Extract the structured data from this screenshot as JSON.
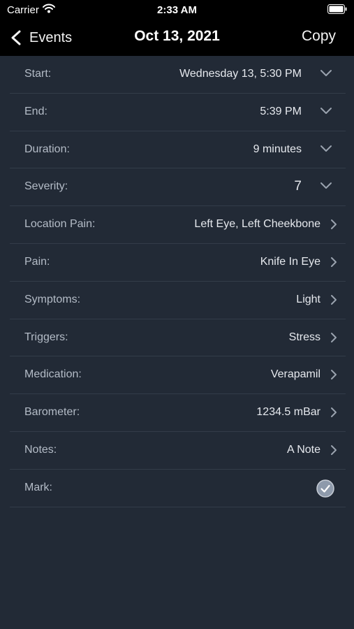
{
  "status_bar": {
    "carrier": "Carrier",
    "time": "2:33 AM"
  },
  "nav": {
    "back_label": "Events",
    "title": "Oct 13, 2021",
    "copy_label": "Copy"
  },
  "rows": [
    {
      "label": "Start:",
      "value": "Wednesday  13,  5:30 PM",
      "accessory": "chevron-down"
    },
    {
      "label": "End:",
      "value": "5:39 PM",
      "accessory": "chevron-down"
    },
    {
      "label": "Duration:",
      "value": "9 minutes",
      "accessory": "chevron-down"
    },
    {
      "label": "Severity:",
      "value": "7",
      "accessory": "chevron-down"
    },
    {
      "label": "Location Pain:",
      "value": "Left Eye, Left Cheekbone",
      "accessory": "chevron-right"
    },
    {
      "label": "Pain:",
      "value": "Knife In Eye",
      "accessory": "chevron-right"
    },
    {
      "label": "Symptoms:",
      "value": "Light",
      "accessory": "chevron-right"
    },
    {
      "label": "Triggers:",
      "value": "Stress",
      "accessory": "chevron-right"
    },
    {
      "label": "Medication:",
      "value": "Verapamil",
      "accessory": "chevron-right"
    },
    {
      "label": "Barometer:",
      "value": "1234.5 mBar",
      "accessory": "chevron-right"
    },
    {
      "label": "Notes:",
      "value": "A Note",
      "accessory": "chevron-right"
    },
    {
      "label": "Mark:",
      "checked": true,
      "accessory": "check"
    }
  ],
  "colors": {
    "background": "#222a36",
    "bar": "#000000",
    "separator": "#333c49",
    "check_fill": "#8e9aab"
  }
}
